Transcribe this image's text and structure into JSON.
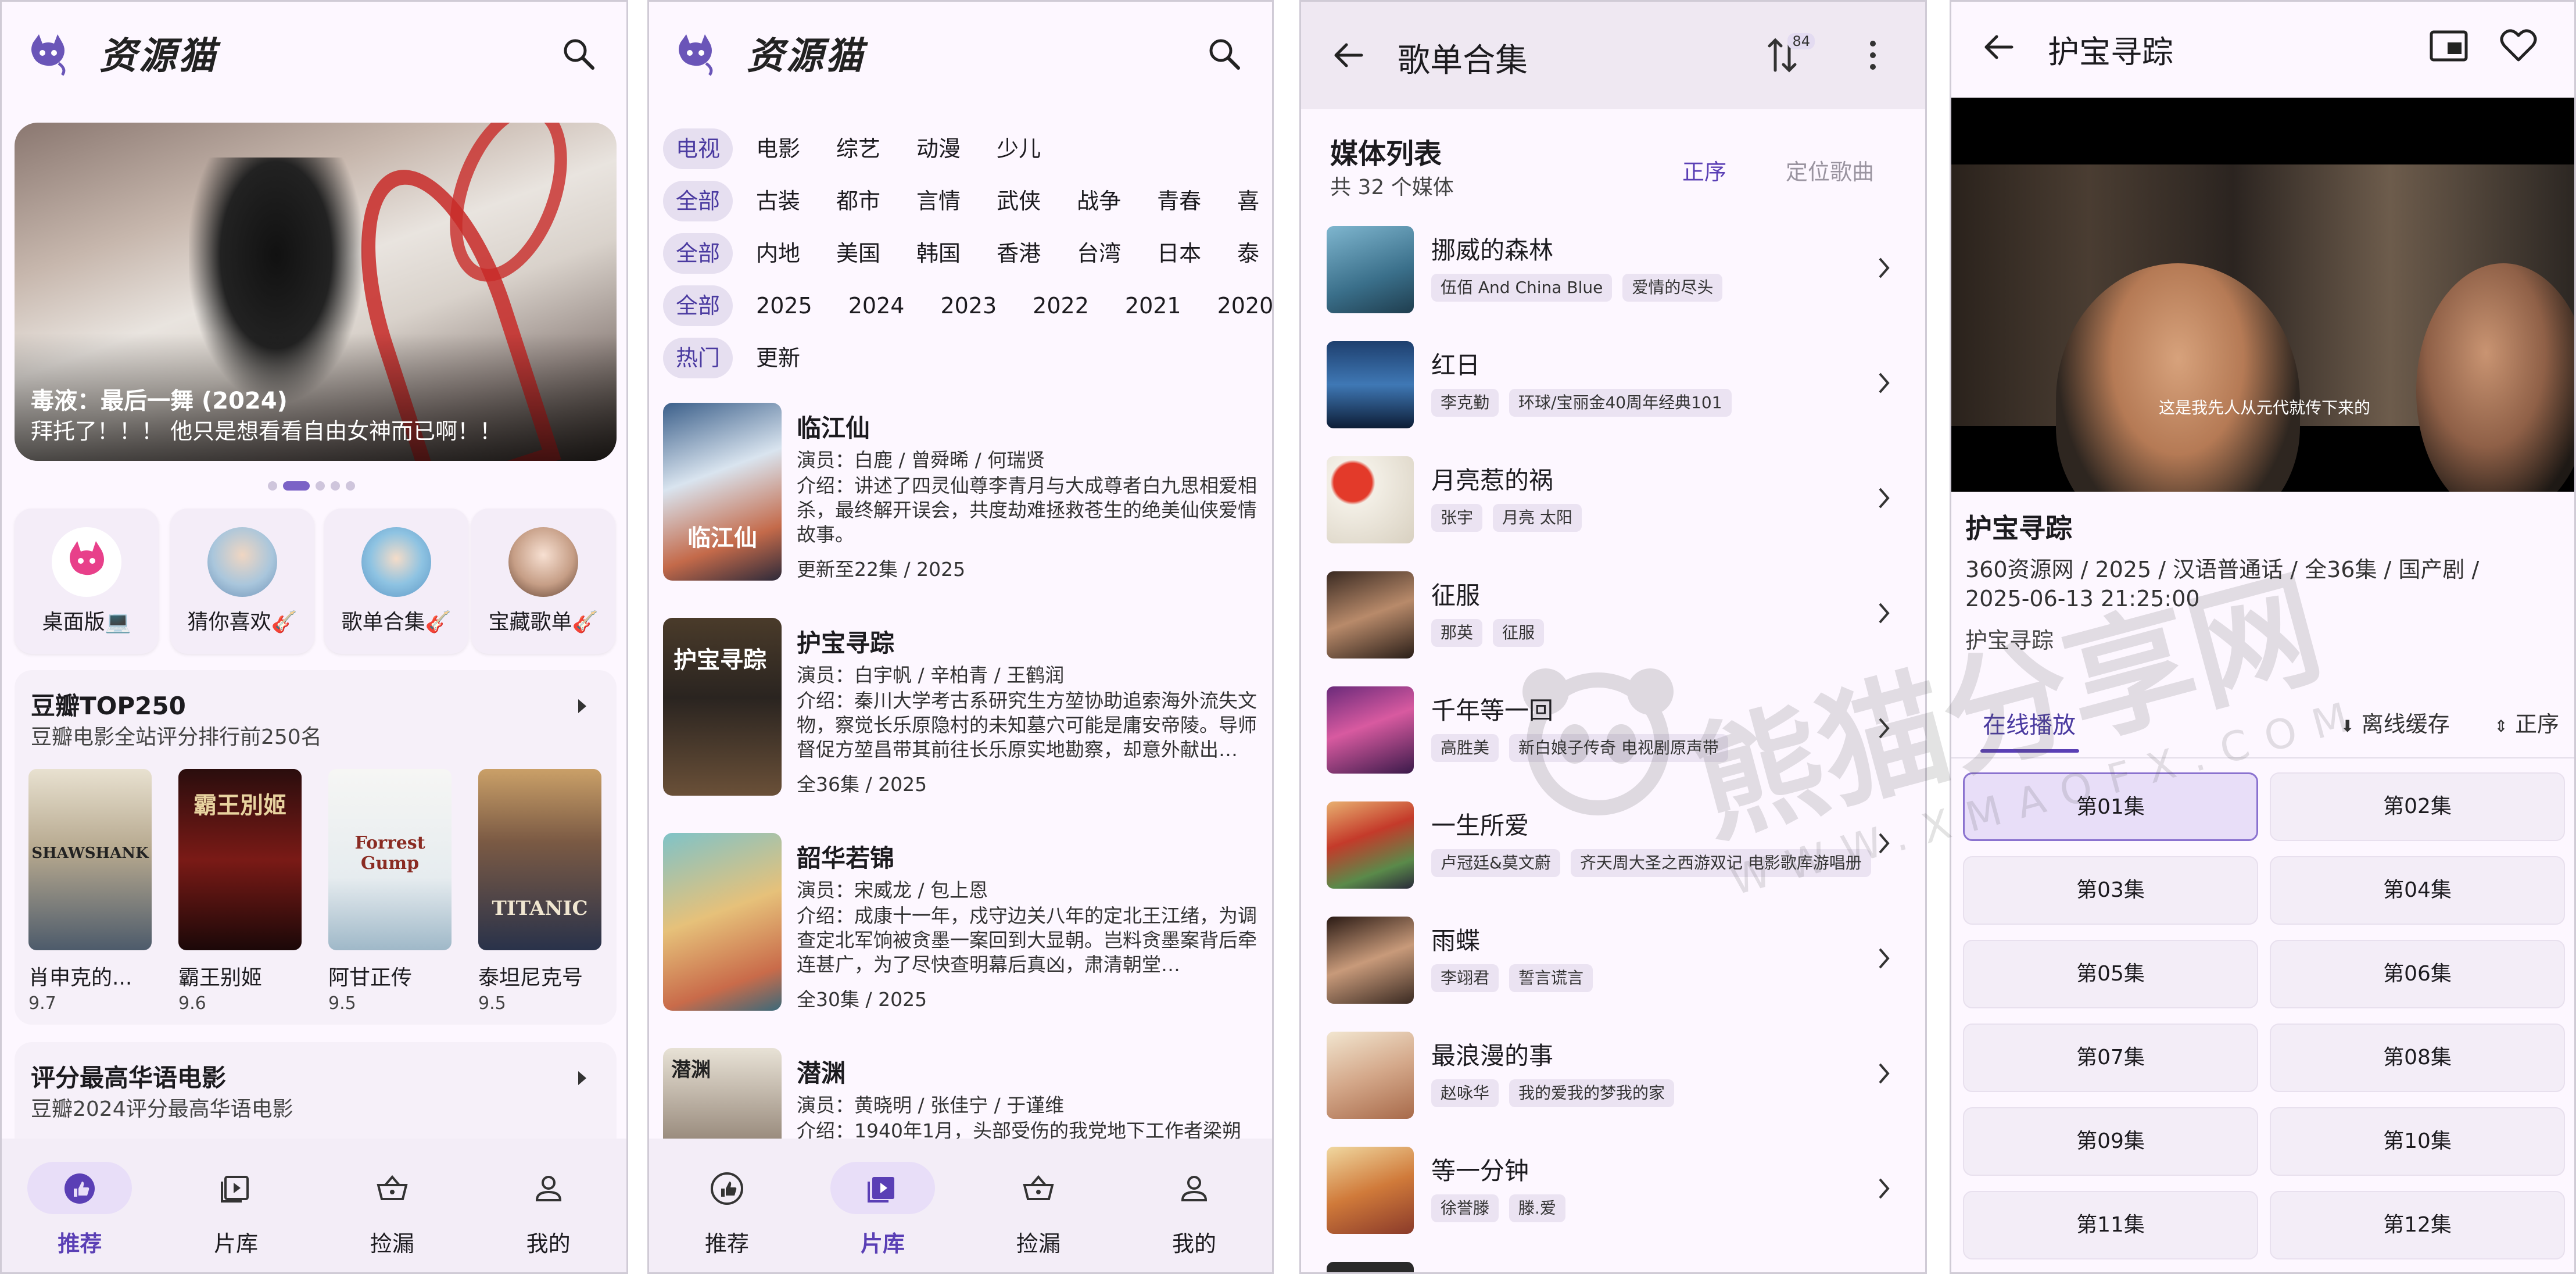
{
  "colors": {
    "accent": "#5a3fb5",
    "selected_bg": "#e8def8",
    "surface": "#fdf7ff",
    "banner_red": "#c82a28"
  },
  "home": {
    "brand": "资源猫",
    "banner": {
      "title": "毒液：最后一舞 (2024)",
      "subtitle": "拜托了！！！ 他只是想看看自由女神而已啊！！"
    },
    "carousel": {
      "pages": 5,
      "active": 1
    },
    "quick_entries": [
      {
        "label": "桌面版💻",
        "icon": "cat-logo-icon"
      },
      {
        "label": "猜你喜欢🎸",
        "icon": "avatar-boy"
      },
      {
        "label": "歌单合集🎸",
        "icon": "avatar-anime"
      },
      {
        "label": "宝藏歌单🎸",
        "icon": "avatar-girl"
      }
    ],
    "douban": {
      "title": "豆瓣TOP250",
      "subtitle": "豆瓣电影全站评分排行前250名",
      "movies": [
        {
          "name": "肖申克的...",
          "score": "9.7",
          "poster_text": "SHAWSHANK"
        },
        {
          "name": "霸王别姬",
          "score": "9.6",
          "poster_text": "霸王別姬"
        },
        {
          "name": "阿甘正传",
          "score": "9.5",
          "poster_text": "Forrest Gump"
        },
        {
          "name": "泰坦尼克号",
          "score": "9.5",
          "poster_text": "TITANIC"
        }
      ]
    },
    "chinese_card": {
      "title": "评分最高华语电影",
      "subtitle": "豆瓣2024评分最高华语电影"
    }
  },
  "nav": {
    "tabs": [
      "推荐",
      "片库",
      "捡漏",
      "我的"
    ]
  },
  "library": {
    "brand": "资源猫",
    "filters": [
      [
        "电视",
        "电影",
        "综艺",
        "动漫",
        "少儿"
      ],
      [
        "全部",
        "古装",
        "都市",
        "言情",
        "武侠",
        "战争",
        "青春",
        "喜"
      ],
      [
        "全部",
        "内地",
        "美国",
        "韩国",
        "香港",
        "台湾",
        "日本",
        "泰"
      ],
      [
        "全部",
        "2025",
        "2024",
        "2023",
        "2022",
        "2021",
        "2020"
      ],
      [
        "热门",
        "更新"
      ]
    ],
    "items": [
      {
        "title": "临江仙",
        "actors": "演员：白鹿 / 曾舜晞 / 何瑞贤",
        "desc": "介绍：讲述了四灵仙尊李青月与大成尊者白九思相爱相杀，最终解开误会，共度劫难拯救苍生的绝美仙侠爱情故事。",
        "meta": "更新至22集 / 2025",
        "poster_text": "临江仙"
      },
      {
        "title": "护宝寻踪",
        "actors": "演员：白宇帆 / 辛柏青 / 王鹤润",
        "desc": "介绍：秦川大学考古系研究生方堃协助追索海外流失文物，察觉长乐原隐村的未知墓穴可能是庸安帝陵。导师督促方堃昌带其前往长乐原实地勘察，却意外献出…",
        "meta": "全36集 / 2025",
        "poster_text": "护宝寻踪"
      },
      {
        "title": "韶华若锦",
        "actors": "演员：宋威龙 / 包上恩",
        "desc": "介绍：成康十一年，戍守边关八年的定北王江绪，为调查定北军饷被贪墨一案回到大显朝。岂料贪墨案背后牵连甚广，为了尽快查明幕后真凶，肃清朝堂…",
        "meta": "全30集 / 2025",
        "poster_text": ""
      },
      {
        "title": "潜渊",
        "actors": "演员：黄晓明 / 张佳宁 / 于谨维",
        "desc": "介绍：1940年1月，头部受伤的我党地下工作者梁朔",
        "meta": "",
        "poster_text": "潜渊"
      }
    ]
  },
  "playlist": {
    "title": "歌单合集",
    "sort_badge": "84",
    "header": "媒体列表",
    "count": "共 32 个媒体",
    "order_btn": "正序",
    "locate_btn": "定位歌曲",
    "songs": [
      {
        "name": "挪威的森林",
        "tags": [
          "伍佰 And China Blue",
          "爱情的尽头"
        ]
      },
      {
        "name": "红日",
        "tags": [
          "李克勤",
          "环球/宝丽金40周年经典101"
        ]
      },
      {
        "name": "月亮惹的祸",
        "tags": [
          "张宇",
          "月亮 太阳"
        ]
      },
      {
        "name": "征服",
        "tags": [
          "那英",
          "征服"
        ]
      },
      {
        "name": "千年等一回",
        "tags": [
          "高胜美",
          "新白娘子传奇 电视剧原声带"
        ]
      },
      {
        "name": "一生所爱",
        "tags": [
          "卢冠廷&莫文蔚",
          "齐天周大圣之西游双记 电影歌库游唱册"
        ]
      },
      {
        "name": "雨蝶",
        "tags": [
          "李翊君",
          "誓言谎言"
        ]
      },
      {
        "name": "最浪漫的事",
        "tags": [
          "赵咏华",
          "我的爱我的梦我的家"
        ]
      },
      {
        "name": "等一分钟",
        "tags": [
          "徐誉滕",
          "滕.爱"
        ]
      }
    ]
  },
  "detail": {
    "title": "护宝寻踪",
    "subtitle_line": "这是我先人从元代就传下来的",
    "name": "护宝寻踪",
    "meta": "360资源网 / 2025 / 汉语普通话 / 全36集 / 国产剧 / 2025-06-13 21:25:00",
    "source": "护宝寻踪",
    "tab_online": "在线播放",
    "offline": "离线缓存",
    "order": "正序",
    "episodes": [
      "第01集",
      "第02集",
      "第03集",
      "第04集",
      "第05集",
      "第06集",
      "第07集",
      "第08集",
      "第09集",
      "第10集",
      "第11集",
      "第12集"
    ]
  },
  "watermark": {
    "text": "熊猫分享网",
    "sub": "WWW.XMAOFX.COM"
  }
}
